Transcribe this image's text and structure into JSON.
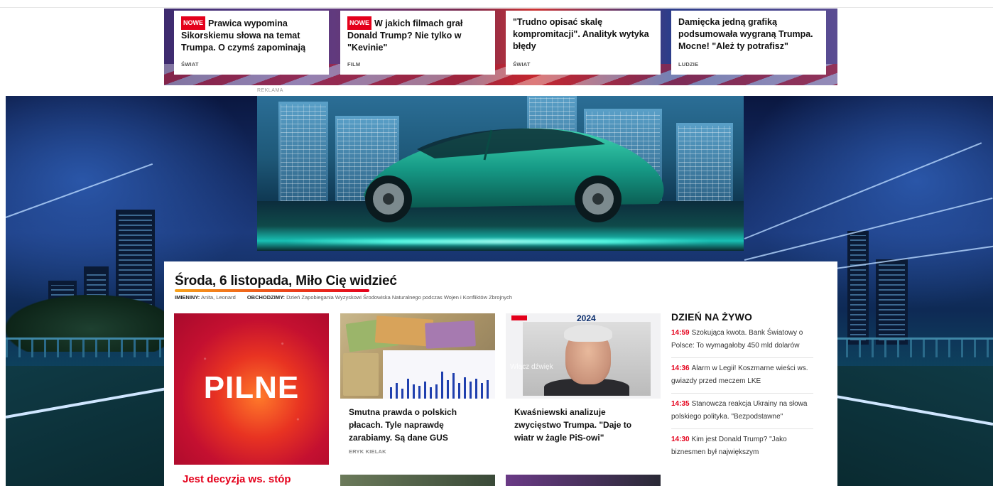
{
  "top_articles": [
    {
      "badge": "NOWE",
      "title": "Prawica wypomina Sikorskiemu słowa na temat Trumpa. O czymś zapominają",
      "category": "ŚWIAT"
    },
    {
      "badge": "NOWE",
      "title": "W jakich filmach grał Donald Trump? Nie tylko w \"Kevinie\"",
      "category": "FILM"
    },
    {
      "badge": "",
      "title": "\"Trudno opisać skalę kompromitacji\". Analityk wytyka błędy",
      "category": "ŚWIAT"
    },
    {
      "badge": "",
      "title": "Damięcka jedną grafiką podsumowała wygraną Trumpa. Mocne! \"Ależ ty potrafisz\"",
      "category": "LUDZIE"
    }
  ],
  "ad_label": "REKLAMA",
  "header": {
    "date_greeting": "Środa, 6 listopada, Miło Cię widzieć",
    "names_label": "IMIENINY:",
    "names_value": "Anita, Leonard",
    "holiday_label": "OBCHODZIMY:",
    "holiday_value": "Dzień Zapobiegania Wyzyskowi Środowiska Naturalnego podczas Wojen i Konfliktów Zbrojnych"
  },
  "pilne_card": {
    "word": "PILNE",
    "title": "Jest decyzja ws. stóp"
  },
  "articles": [
    {
      "title": "Smutna prawda o polskich płacach. Tyle naprawdę zarabiamy. Są dane GUS",
      "author": "ERYK KIELAK"
    },
    {
      "title": "Kwaśniewski analizuje zwycięstwo Trumpa. \"Daje to wiatr w żagle PiS-owi\"",
      "author": "",
      "image_year": "2024",
      "image_watermark": "Włącz dźwięk"
    }
  ],
  "live": {
    "header": "DZIEŃ NA ŻYWO",
    "items": [
      {
        "time": "14:59",
        "text": "Szokująca kwota. Bank Światowy o Polsce: To wymagałoby 450 mld dolarów"
      },
      {
        "time": "14:36",
        "text": "Alarm w Legii! Koszmarne wieści ws. gwiazdy przed meczem LKE"
      },
      {
        "time": "14:35",
        "text": "Stanowcza reakcja Ukrainy na słowa polskiego polityka. \"Bezpodstawne\""
      },
      {
        "time": "14:30",
        "text": "Kim jest Donald Trump? \"Jako biznesmen był największym"
      }
    ]
  },
  "colors": {
    "accent": "#e4001b",
    "underline_start": "#f7a21b",
    "underline_end": "#e4001b"
  }
}
